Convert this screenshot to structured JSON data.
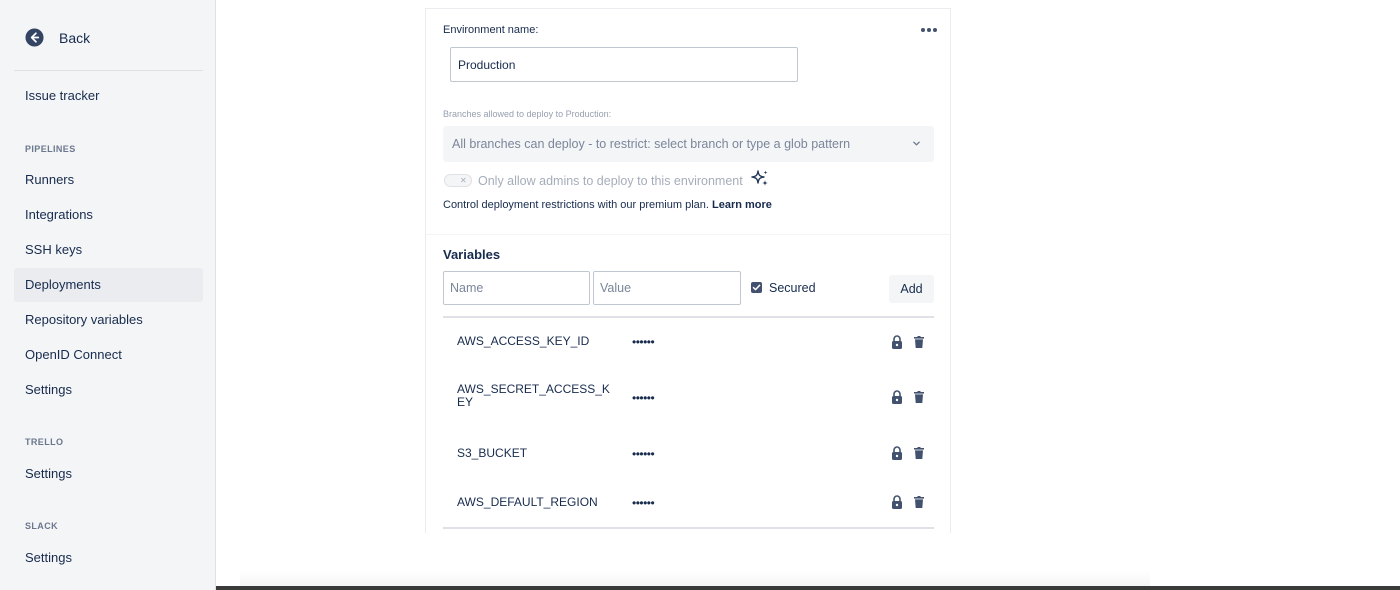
{
  "sidebar": {
    "back_label": "Back",
    "issue_tracker": "Issue tracker",
    "sections": [
      {
        "title": "PIPELINES",
        "items": [
          {
            "label": "Runners"
          },
          {
            "label": "Integrations"
          },
          {
            "label": "SSH keys"
          },
          {
            "label": "Deployments",
            "active": true
          },
          {
            "label": "Repository variables"
          },
          {
            "label": "OpenID Connect"
          },
          {
            "label": "Settings"
          }
        ]
      },
      {
        "title": "TRELLO",
        "items": [
          {
            "label": "Settings"
          }
        ]
      },
      {
        "title": "SLACK",
        "items": [
          {
            "label": "Settings"
          }
        ]
      }
    ]
  },
  "environment": {
    "name_label": "Environment name:",
    "name_value": "Production",
    "more_icon": "more-horizontal-icon",
    "branches_label": "Branches allowed to deploy to Production:",
    "branches_placeholder": "All branches can deploy - to restrict: select branch or type a glob pattern",
    "admin_toggle_label": "Only allow admins to deploy to this environment",
    "admin_toggle_on": false,
    "premium_text": "Control deployment restrictions with our premium plan.",
    "learn_more": "Learn more"
  },
  "variables": {
    "title": "Variables",
    "name_placeholder": "Name",
    "value_placeholder": "Value",
    "secured_label": "Secured",
    "secured_checked": true,
    "add_label": "Add",
    "rows": [
      {
        "name": "AWS_ACCESS_KEY_ID",
        "value": "••••••",
        "secured": true
      },
      {
        "name": "AWS_SECRET_ACCESS_KEY",
        "value": "••••••",
        "secured": true
      },
      {
        "name": "S3_BUCKET",
        "value": "••••••",
        "secured": true
      },
      {
        "name": "AWS_DEFAULT_REGION",
        "value": "••••••",
        "secured": true
      }
    ]
  },
  "colors": {
    "sidebar_bg": "#f4f5f7",
    "active_item_bg": "#ebecf0",
    "text": "#172b4d",
    "muted_text": "#7a869a",
    "checkbox_fill": "#42526e"
  }
}
